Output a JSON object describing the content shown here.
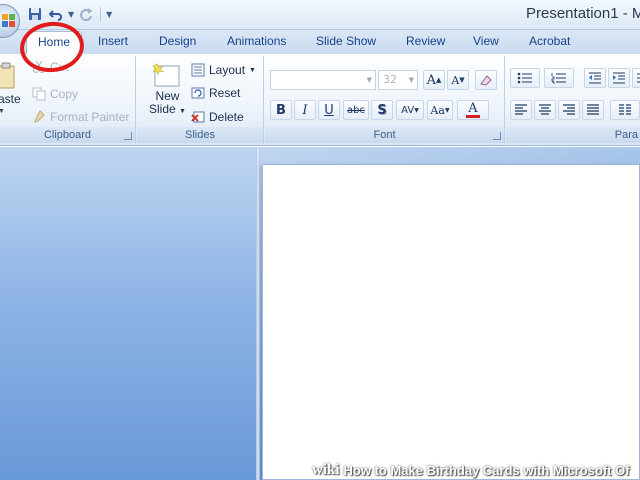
{
  "window": {
    "title": "Presentation1 - M"
  },
  "quick_access": {
    "icons": [
      "save-icon",
      "undo-icon",
      "redo-icon",
      "customize-icon"
    ]
  },
  "tabs": [
    {
      "label": "Home",
      "active": true
    },
    {
      "label": "Insert"
    },
    {
      "label": "Design"
    },
    {
      "label": "Animations"
    },
    {
      "label": "Slide Show"
    },
    {
      "label": "Review"
    },
    {
      "label": "View"
    },
    {
      "label": "Acrobat"
    }
  ],
  "clipboard": {
    "paste_label": "aste",
    "cut_label": "Cut",
    "copy_label": "Copy",
    "format_painter_label": "Format Painter",
    "group_label": "Clipboard"
  },
  "slides": {
    "new_slide_line1": "New",
    "new_slide_line2": "Slide",
    "layout_label": "Layout",
    "reset_label": "Reset",
    "delete_label": "Delete",
    "group_label": "Slides"
  },
  "font": {
    "font_name_value": "",
    "font_size_value": "32",
    "grow_label": "A",
    "shrink_label": "A",
    "bold_label": "B",
    "italic_label": "I",
    "underline_label": "U",
    "strike_label": "abc",
    "shadow_label": "S",
    "spacing_label": "AV",
    "case_label": "Aa",
    "color_label": "A",
    "group_label": "Font"
  },
  "paragraph": {
    "group_label": "Para"
  },
  "watermark": {
    "brand": "wiki",
    "text": "How to Make Birthday Cards with Microsoft Of"
  },
  "colors": {
    "accent": "#15428b",
    "highlight_circle": "#e01c1c",
    "workspace": "#7fa9dd"
  }
}
